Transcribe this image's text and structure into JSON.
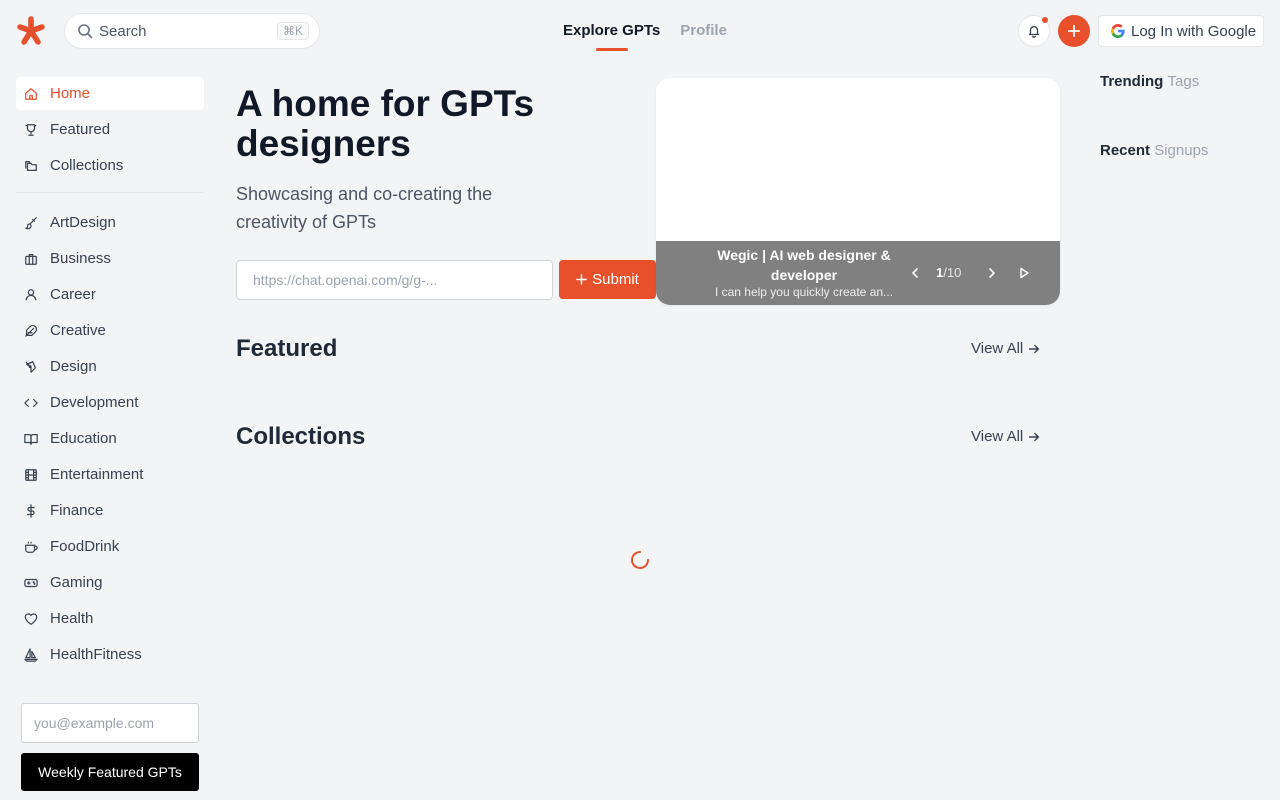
{
  "header": {
    "search_label": "Search",
    "search_shortcut": "⌘K",
    "tabs": [
      {
        "label": "Explore GPTs",
        "active": true
      },
      {
        "label": "Profile",
        "active": false
      }
    ],
    "login_label": "Log In with Google"
  },
  "sidebar": {
    "primary": [
      {
        "label": "Home",
        "icon": "home-icon",
        "active": true
      },
      {
        "label": "Featured",
        "icon": "trophy-icon"
      },
      {
        "label": "Collections",
        "icon": "folders-icon"
      }
    ],
    "categories": [
      {
        "label": "ArtDesign",
        "icon": "brush-icon"
      },
      {
        "label": "Business",
        "icon": "briefcase-icon"
      },
      {
        "label": "Career",
        "icon": "user-icon"
      },
      {
        "label": "Creative",
        "icon": "feather-icon"
      },
      {
        "label": "Design",
        "icon": "pen-tool-icon"
      },
      {
        "label": "Development",
        "icon": "code-icon"
      },
      {
        "label": "Education",
        "icon": "book-icon"
      },
      {
        "label": "Entertainment",
        "icon": "film-icon"
      },
      {
        "label": "Finance",
        "icon": "dollar-icon"
      },
      {
        "label": "FoodDrink",
        "icon": "coffee-icon"
      },
      {
        "label": "Gaming",
        "icon": "gamepad-icon"
      },
      {
        "label": "Health",
        "icon": "heart-icon"
      },
      {
        "label": "HealthFitness",
        "icon": "sailboat-icon"
      }
    ],
    "email_placeholder": "you@example.com",
    "weekly_button": "Weekly Featured GPTs"
  },
  "hero": {
    "title": "A home for GPTs designers",
    "subtitle": "Showcasing and co-creating the creativity of GPTs",
    "url_placeholder": "https://chat.openai.com/g/g-...",
    "submit_label": "Submit"
  },
  "carousel": {
    "title": "Wegic | AI web designer & developer",
    "description": "I can help you quickly create an...",
    "current": "1",
    "total": "/10"
  },
  "sections": {
    "featured": {
      "title": "Featured",
      "view_all": "View All"
    },
    "collections": {
      "title": "Collections",
      "view_all": "View All"
    }
  },
  "right": {
    "trending": {
      "strong": "Trending",
      "muted": "Tags"
    },
    "recent": {
      "strong": "Recent",
      "muted": "Signups"
    }
  },
  "colors": {
    "accent": "#e8502b",
    "background": "#f3f4f6",
    "caption_bg": "#808080"
  }
}
